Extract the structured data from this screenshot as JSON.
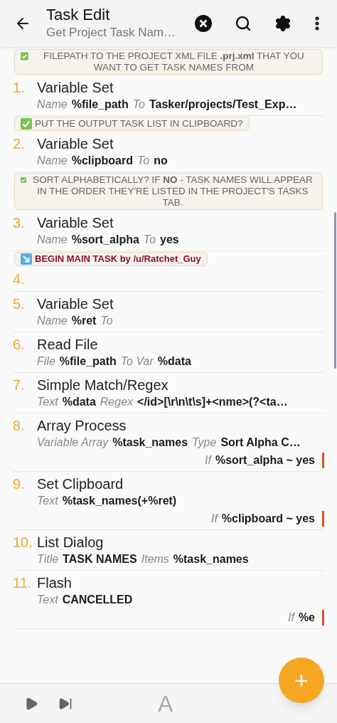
{
  "header": {
    "title": "Task Edit",
    "subtitle": "Get Project Task Nam…"
  },
  "steps": [
    {
      "kind": "comment",
      "text": "FILEPATH TO THE PROJECT XML FILE **.prj.xml** THAT YOU WANT TO GET TASK NAMES FROM"
    },
    {
      "kind": "action",
      "number": "1.",
      "name": "Variable Set",
      "params": [
        {
          "label": "Name",
          "value": "%file_path"
        },
        {
          "label": "To",
          "value": "Tasker/projects/Test_Exp…"
        }
      ]
    },
    {
      "kind": "comment",
      "text": "PUT THE OUTPUT TASK LIST IN CLIPBOARD?"
    },
    {
      "kind": "action",
      "number": "2.",
      "name": "Variable Set",
      "params": [
        {
          "label": "Name",
          "value": "%clipboard"
        },
        {
          "label": "To",
          "value": "no"
        }
      ]
    },
    {
      "kind": "comment",
      "text": "SORT ALPHABETICALLY? IF **NO** - TASK NAMES WILL APPEAR IN THE ORDER THEY'RE LISTED IN THE PROJECT'S TASKS TAB."
    },
    {
      "kind": "action",
      "number": "3.",
      "name": "Variable Set",
      "params": [
        {
          "label": "Name",
          "value": "%sort_alpha"
        },
        {
          "label": "To",
          "value": "yes"
        }
      ]
    },
    {
      "kind": "section",
      "text": "BEGIN MAIN TASK by /u/Ratchet_Guy"
    },
    {
      "kind": "action",
      "number": "4."
    },
    {
      "kind": "action",
      "number": "5.",
      "name": "Variable Set",
      "params": [
        {
          "label": "Name",
          "value": "%ret"
        },
        {
          "label": "To"
        }
      ]
    },
    {
      "kind": "action",
      "number": "6.",
      "name": "Read File",
      "params": [
        {
          "label": "File",
          "value": "%file_path"
        },
        {
          "label": "To Var",
          "value": "%data"
        }
      ]
    },
    {
      "kind": "action",
      "number": "7.",
      "name": "Simple Match/Regex",
      "params": [
        {
          "label": "Text",
          "value": "%data"
        },
        {
          "label": "Regex",
          "value": "</id>[\\r\\n\\t\\s]+<nme>(?<ta…"
        }
      ]
    },
    {
      "kind": "action",
      "number": "8.",
      "name": "Array Process",
      "params": [
        {
          "label": "Variable Array",
          "value": "%task_names"
        },
        {
          "label": "Type",
          "value": "Sort Alpha C…"
        }
      ],
      "condition": {
        "label": "If",
        "value": "%sort_alpha ~ yes"
      }
    },
    {
      "kind": "action",
      "number": "9.",
      "name": "Set Clipboard",
      "params": [
        {
          "label": "Text",
          "value": "%task_names(+%ret)"
        }
      ],
      "condition": {
        "label": "If",
        "value": "%clipboard ~ yes"
      }
    },
    {
      "kind": "action",
      "number": "10.",
      "name": "List Dialog",
      "params": [
        {
          "label": "Title",
          "value": "TASK NAMES"
        },
        {
          "label": "Items",
          "value": "%task_names"
        }
      ]
    },
    {
      "kind": "action",
      "number": "11.",
      "name": "Flash",
      "params": [
        {
          "label": "Text",
          "value": "CANCELLED"
        }
      ],
      "condition": {
        "label": "If",
        "value": "%e"
      }
    }
  ],
  "bottom_bar": {
    "text_button": "A"
  },
  "fab": {
    "label": "+"
  }
}
